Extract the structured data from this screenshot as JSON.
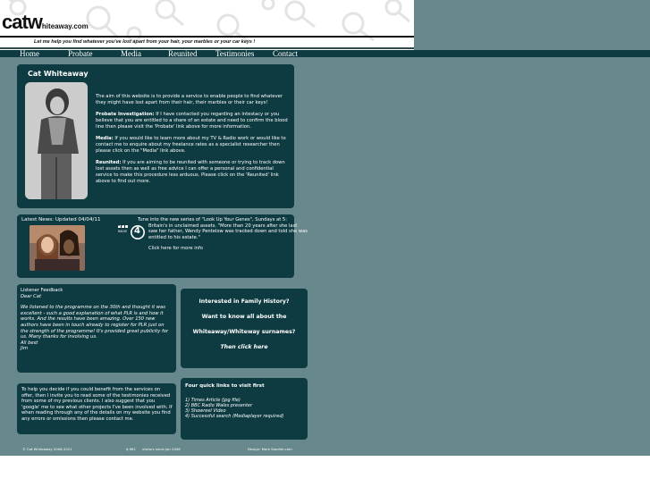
{
  "header": {
    "logo_big": "catw",
    "logo_small": "hiteaway.com",
    "tagline": "Let me help you find whatever you've lost apart from your hair, your marbles or your car keys !"
  },
  "nav": {
    "items": [
      {
        "label": "Home"
      },
      {
        "label": "Probate"
      },
      {
        "label": "Media"
      },
      {
        "label": "Reunited"
      },
      {
        "label": "Testimonies"
      },
      {
        "label": "Contact"
      }
    ]
  },
  "intro": {
    "title": "Cat Whiteaway",
    "para1": "The aim of this website is to provide a service to enable people to find whatever they might have lost apart from their hair, their marbles or their car keys!",
    "probate_label": "Probate Investigation:",
    "probate_text": " If I have contacted you regarding an intestacy or you believe that you are entitled to a share of an estate and need to confirm the blood line then please visit the 'Probate' link above for more information.",
    "media_label": "Media:",
    "media_text": " If you would like to learn more about my TV & Radio work or would like to contact me to enquire about my freelance rates as a specialist researcher then please click on the \"Media\" link above.",
    "reunited_label": "Reunited:",
    "reunited_text": " If you are aiming to be reunited with someone or trying to track down lost assets then as well as free advice I can offer a personal and confidential service to make this procedure less arduous. Please click on the 'Reunited' link above to find out more."
  },
  "news": {
    "title": "Latest News: Updated 04/04/11",
    "logo_top": "BBC",
    "logo_sub": "RADIO",
    "logo_num": "4",
    "line1": "Tune into the new series of \"Look Up Your Genes\", Sundays at 5:",
    "line2": "Britain's in unclaimed assets. \"More than 20 years after she last saw her father,   Wendy Pentelow was tracked down and told she was entitled to his estate.\"",
    "link": "Click here for more info"
  },
  "feedback": {
    "title": "Listener Feedback",
    "salutation": "Dear Cat",
    "body": "We listened to the programme on the 30th and thought it was excellent - such a good explanation of what PLR is and how it works. And the results have been amazing.  Over 150 new authors have been in touch already to register for PLR just on the strength of the programme! It's provided great publicity for us.  Many thanks for involving us.",
    "signoff": "All best",
    "name": "Jim"
  },
  "family": {
    "line1": "Interested in Family History?",
    "line2": "Want to know all about the",
    "line3": "Whiteaway/Whiteway surnames?",
    "link": "Then click here"
  },
  "testimonials": {
    "text": "To help you decide if you could benefit from the services on offer, then I invite you to read some of the testimonies received from some of my previous clients. I also suggest that you 'google' me to see what other projects I've been involved with. If when reading through any of the details on my website you find any errors or omissions then please contact me."
  },
  "quicklinks": {
    "title": "Four quick links to visit first",
    "items": [
      {
        "label": "1) Times Article (jpg file)"
      },
      {
        "label": "2) BBC Radio Wales presenter"
      },
      {
        "label": "3) Showreel Video"
      },
      {
        "label": "4) Successful search (Mediaplayer required)"
      }
    ]
  },
  "footer": {
    "copyright": "© Cat Whiteaway 2006-2011",
    "counter_num": "6,961",
    "counter_text": "visitors since Jan 2008",
    "design": "Design: Mark Sandler.com"
  },
  "colors": {
    "page_bg": "#67898d",
    "panel_bg": "#0e3b41",
    "nav_bg": "#0e3b41",
    "text": "#ffffff"
  }
}
